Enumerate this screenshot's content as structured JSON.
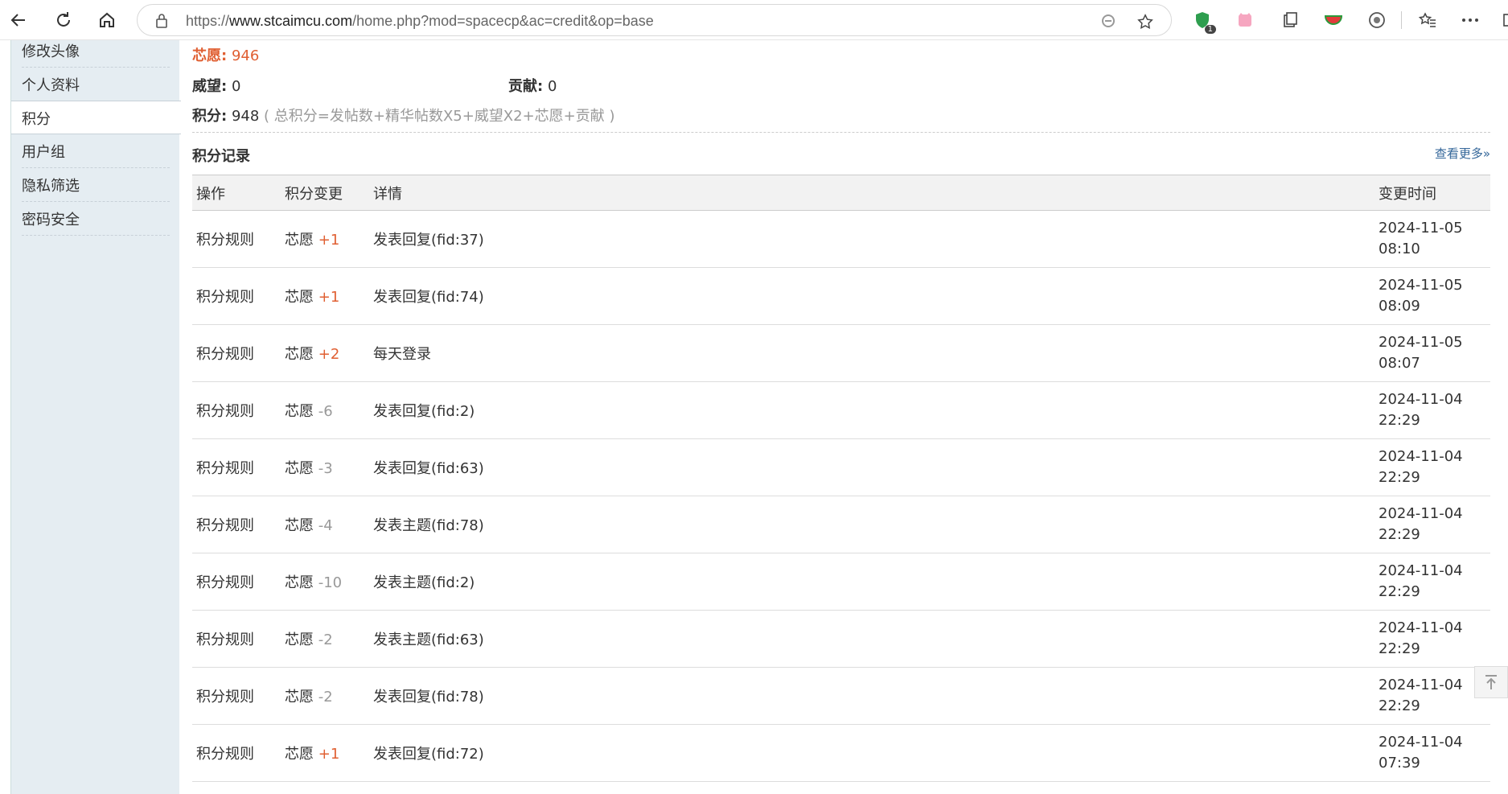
{
  "browser": {
    "url_prefix": "https://",
    "url_host": "www.stcaimcu.com",
    "url_path": "/home.php?mod=spacecp&ac=credit&op=base",
    "ext_badge": "1"
  },
  "sidebar": {
    "items": [
      {
        "label": "修改头像"
      },
      {
        "label": "个人资料"
      },
      {
        "label": "积分"
      },
      {
        "label": "用户组"
      },
      {
        "label": "隐私筛选"
      },
      {
        "label": "密码安全"
      }
    ]
  },
  "stats": {
    "xinyuan_label": "芯愿:",
    "xinyuan_value": "946",
    "weiwang_label": "威望:",
    "weiwang_value": "0",
    "gongxian_label": "贡献:",
    "gongxian_value": "0",
    "jifen_label": "积分:",
    "jifen_value": "948",
    "jifen_formula": "( 总积分=发帖数+精华帖数X5+威望X2+芯愿+贡献 )"
  },
  "log": {
    "title": "积分记录",
    "more": "查看更多»",
    "headers": [
      "操作",
      "积分变更",
      "详情",
      "变更时间"
    ],
    "rows": [
      {
        "op": "积分规则",
        "type": "芯愿",
        "delta": "+1",
        "detail": "发表回复(fid:37)",
        "date": "2024-11-05",
        "time": "08:10"
      },
      {
        "op": "积分规则",
        "type": "芯愿",
        "delta": "+1",
        "detail": "发表回复(fid:74)",
        "date": "2024-11-05",
        "time": "08:09"
      },
      {
        "op": "积分规则",
        "type": "芯愿",
        "delta": "+2",
        "detail": "每天登录",
        "date": "2024-11-05",
        "time": "08:07"
      },
      {
        "op": "积分规则",
        "type": "芯愿",
        "delta": "-6",
        "detail": "发表回复(fid:2)",
        "date": "2024-11-04",
        "time": "22:29"
      },
      {
        "op": "积分规则",
        "type": "芯愿",
        "delta": "-3",
        "detail": "发表回复(fid:63)",
        "date": "2024-11-04",
        "time": "22:29"
      },
      {
        "op": "积分规则",
        "type": "芯愿",
        "delta": "-4",
        "detail": "发表主题(fid:78)",
        "date": "2024-11-04",
        "time": "22:29"
      },
      {
        "op": "积分规则",
        "type": "芯愿",
        "delta": "-10",
        "detail": "发表主题(fid:2)",
        "date": "2024-11-04",
        "time": "22:29"
      },
      {
        "op": "积分规则",
        "type": "芯愿",
        "delta": "-2",
        "detail": "发表主题(fid:63)",
        "date": "2024-11-04",
        "time": "22:29"
      },
      {
        "op": "积分规则",
        "type": "芯愿",
        "delta": "-2",
        "detail": "发表回复(fid:78)",
        "date": "2024-11-04",
        "time": "22:29"
      },
      {
        "op": "积分规则",
        "type": "芯愿",
        "delta": "+1",
        "detail": "发表回复(fid:72)",
        "date": "2024-11-04",
        "time": "07:39"
      }
    ]
  }
}
